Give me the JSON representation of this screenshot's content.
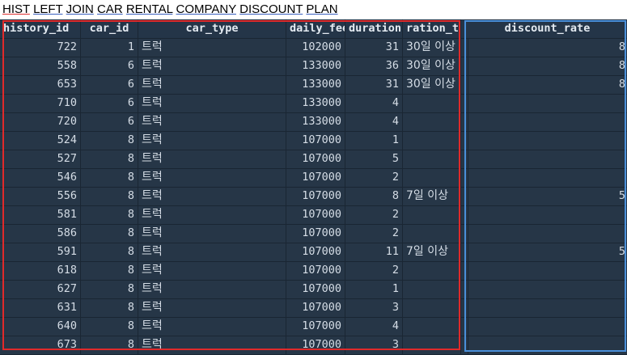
{
  "caption": {
    "words": [
      "HIST",
      "LEFT",
      "JOIN",
      "CAR",
      "RENTAL",
      "COMPANY",
      "DISCOUNT",
      "PLAN"
    ]
  },
  "columns": [
    "history_id",
    "car_id",
    "car_type",
    "daily_fee",
    "duration",
    "ration_ty",
    "discount_rate"
  ],
  "rows": [
    {
      "history_id": "722",
      "car_id": "1",
      "car_type": "트럭",
      "daily_fee": "102000",
      "duration": "31",
      "duration_type": "30일 이상",
      "discount_rate": "8"
    },
    {
      "history_id": "558",
      "car_id": "6",
      "car_type": "트럭",
      "daily_fee": "133000",
      "duration": "36",
      "duration_type": "30일 이상",
      "discount_rate": "8"
    },
    {
      "history_id": "653",
      "car_id": "6",
      "car_type": "트럭",
      "daily_fee": "133000",
      "duration": "31",
      "duration_type": "30일 이상",
      "discount_rate": "8"
    },
    {
      "history_id": "710",
      "car_id": "6",
      "car_type": "트럭",
      "daily_fee": "133000",
      "duration": "4",
      "duration_type": "",
      "discount_rate": ""
    },
    {
      "history_id": "720",
      "car_id": "6",
      "car_type": "트럭",
      "daily_fee": "133000",
      "duration": "4",
      "duration_type": "",
      "discount_rate": ""
    },
    {
      "history_id": "524",
      "car_id": "8",
      "car_type": "트럭",
      "daily_fee": "107000",
      "duration": "1",
      "duration_type": "",
      "discount_rate": ""
    },
    {
      "history_id": "527",
      "car_id": "8",
      "car_type": "트럭",
      "daily_fee": "107000",
      "duration": "5",
      "duration_type": "",
      "discount_rate": ""
    },
    {
      "history_id": "546",
      "car_id": "8",
      "car_type": "트럭",
      "daily_fee": "107000",
      "duration": "2",
      "duration_type": "",
      "discount_rate": ""
    },
    {
      "history_id": "556",
      "car_id": "8",
      "car_type": "트럭",
      "daily_fee": "107000",
      "duration": "8",
      "duration_type": "7일 이상",
      "discount_rate": "5"
    },
    {
      "history_id": "581",
      "car_id": "8",
      "car_type": "트럭",
      "daily_fee": "107000",
      "duration": "2",
      "duration_type": "",
      "discount_rate": ""
    },
    {
      "history_id": "586",
      "car_id": "8",
      "car_type": "트럭",
      "daily_fee": "107000",
      "duration": "2",
      "duration_type": "",
      "discount_rate": ""
    },
    {
      "history_id": "591",
      "car_id": "8",
      "car_type": "트럭",
      "daily_fee": "107000",
      "duration": "11",
      "duration_type": "7일 이상",
      "discount_rate": "5"
    },
    {
      "history_id": "618",
      "car_id": "8",
      "car_type": "트럭",
      "daily_fee": "107000",
      "duration": "2",
      "duration_type": "",
      "discount_rate": ""
    },
    {
      "history_id": "627",
      "car_id": "8",
      "car_type": "트럭",
      "daily_fee": "107000",
      "duration": "1",
      "duration_type": "",
      "discount_rate": ""
    },
    {
      "history_id": "631",
      "car_id": "8",
      "car_type": "트럭",
      "daily_fee": "107000",
      "duration": "3",
      "duration_type": "",
      "discount_rate": ""
    },
    {
      "history_id": "640",
      "car_id": "8",
      "car_type": "트럭",
      "daily_fee": "107000",
      "duration": "4",
      "duration_type": "",
      "discount_rate": ""
    },
    {
      "history_id": "673",
      "car_id": "8",
      "car_type": "트럭",
      "daily_fee": "107000",
      "duration": "3",
      "duration_type": "",
      "discount_rate": ""
    }
  ],
  "colors": {
    "grid_background": "#263647",
    "text": "#d5dde6",
    "highlight_red": "#e02a2a",
    "highlight_blue": "#4a8fd9"
  }
}
